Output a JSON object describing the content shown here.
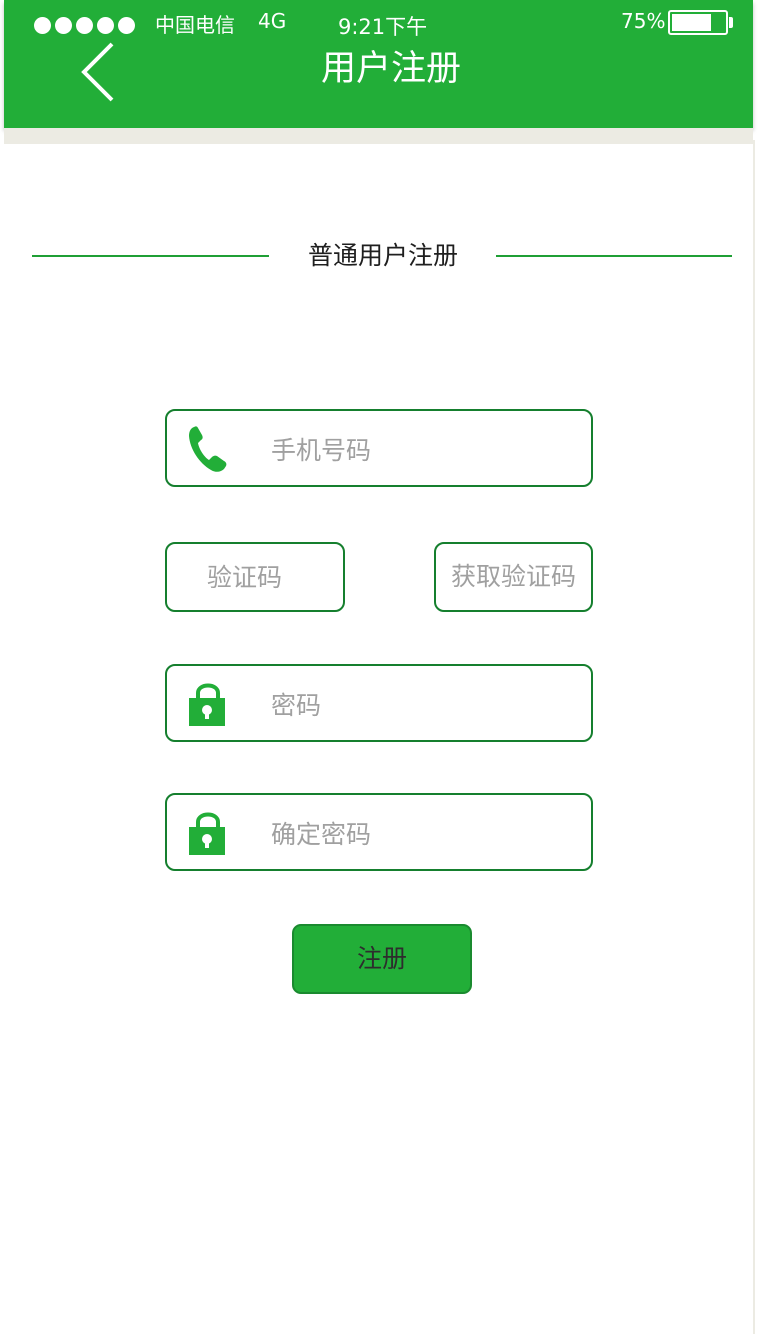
{
  "status_bar": {
    "carrier": "中国电信",
    "network": "4G",
    "time": "9:21下午",
    "battery_percent": "75%",
    "battery_level": 0.75,
    "signal_dots": 5
  },
  "header": {
    "title": "用户注册",
    "back_icon": "chevron-left-icon"
  },
  "section": {
    "title": "普通用户注册"
  },
  "form": {
    "phone": {
      "placeholder": "手机号码",
      "value": "",
      "icon": "phone-icon"
    },
    "verification_code": {
      "placeholder": "验证码",
      "value": ""
    },
    "get_code_label": "获取验证码",
    "password": {
      "placeholder": "密码",
      "value": "",
      "icon": "lock-icon"
    },
    "confirm_password": {
      "placeholder": "确定密码",
      "value": "",
      "icon": "lock-icon"
    },
    "submit_label": "注册"
  },
  "colors": {
    "brand_green": "#22ae38",
    "border_green": "#157f2e",
    "placeholder_gray": "#a0a0a0",
    "background": "#ffffff"
  }
}
